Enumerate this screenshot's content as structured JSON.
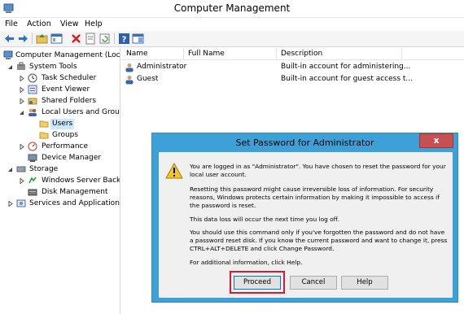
{
  "window": {
    "title": "Computer Management"
  },
  "menu": [
    "File",
    "Action",
    "View",
    "Help"
  ],
  "toolbar": {
    "icons": [
      "back-arrow-icon",
      "forward-arrow-icon",
      "up-folder-icon",
      "show-hide-tree-icon",
      "delete-icon",
      "properties-icon",
      "refresh-icon",
      "help-icon",
      "console-icon"
    ]
  },
  "tree": {
    "items": [
      {
        "label": "Computer Management (Local"
      },
      {
        "label": "System Tools"
      },
      {
        "label": "Task Scheduler"
      },
      {
        "label": "Event Viewer"
      },
      {
        "label": "Shared Folders"
      },
      {
        "label": "Local Users and Groups"
      },
      {
        "label": "Users"
      },
      {
        "label": "Groups"
      },
      {
        "label": "Performance"
      },
      {
        "label": "Device Manager"
      },
      {
        "label": "Storage"
      },
      {
        "label": "Windows Server Backup"
      },
      {
        "label": "Disk Management"
      },
      {
        "label": "Services and Applications"
      }
    ]
  },
  "list": {
    "columns": [
      "Name",
      "Full Name",
      "Description"
    ],
    "rows": [
      {
        "name": "Administrator",
        "full_name": "",
        "description": "Built-in account for administering..."
      },
      {
        "name": "Guest",
        "full_name": "",
        "description": "Built-in account for guest access t..."
      }
    ]
  },
  "dialog": {
    "title": "Set Password for Administrator",
    "close_label": "x",
    "paragraphs": [
      "You are logged in as \"Administrator\". You have chosen to reset the password for your local user account.",
      "Resetting this password might cause irreversible loss of information. For security reasons, Windows protects certain information by making it impossible to access if the password is reset.",
      "This data loss will occur the next time you log off.",
      "You should use this command only if you've forgotten the password and do not have a password reset disk. If you know the current password and want to change it, press CTRL+ALT+DELETE and click Change Password.",
      "For additional information, click Help."
    ],
    "buttons": {
      "proceed": "Proceed",
      "cancel": "Cancel",
      "help": "Help"
    }
  },
  "colors": {
    "dialog_frame": "#3da1d8",
    "close_button": "#c75050",
    "highlight": "#e0182d",
    "selection": "#cce8ff"
  }
}
